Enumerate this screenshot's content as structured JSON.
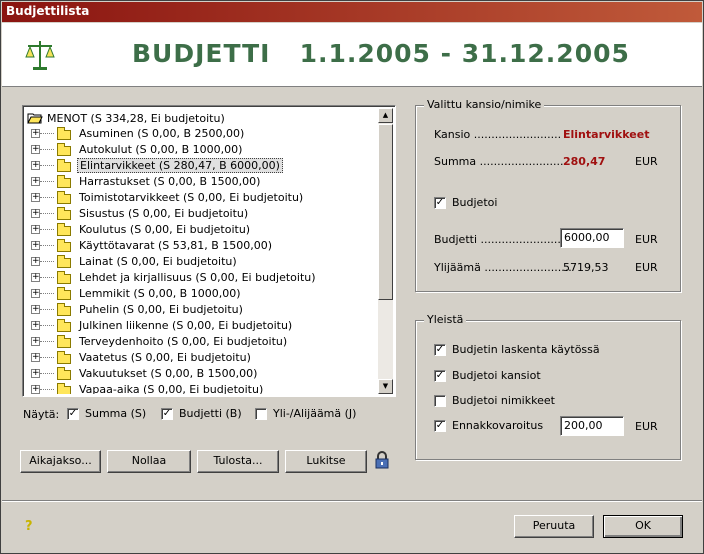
{
  "window": {
    "title": "Budjettilista"
  },
  "header": {
    "title": "BUDJETTI   1.1.2005 - 31.12.2005"
  },
  "tree": {
    "root": "MENOT  (S 334,28, Ei budjetoitu)",
    "items": [
      {
        "label": "Asuminen  (S 0,00, B 2500,00)"
      },
      {
        "label": "Autokulut  (S 0,00, B 1000,00)"
      },
      {
        "label": "Elintarvikkeet  (S 280,47, B 6000,00)",
        "selected": true
      },
      {
        "label": "Harrastukset  (S 0,00, B 1500,00)"
      },
      {
        "label": "Toimistotarvikkeet  (S 0,00, Ei budjetoitu)"
      },
      {
        "label": "Sisustus  (S 0,00, Ei budjetoitu)"
      },
      {
        "label": "Koulutus  (S 0,00, Ei budjetoitu)"
      },
      {
        "label": "Käyttötavarat  (S 53,81, B 1500,00)"
      },
      {
        "label": "Lainat  (S 0,00, Ei budjetoitu)"
      },
      {
        "label": "Lehdet ja kirjallisuus  (S 0,00, Ei budjetoitu)"
      },
      {
        "label": "Lemmikit  (S 0,00, B 1000,00)"
      },
      {
        "label": "Puhelin  (S 0,00, Ei budjetoitu)"
      },
      {
        "label": "Julkinen liikenne  (S 0,00, Ei budjetoitu)"
      },
      {
        "label": "Terveydenhoito  (S 0,00, Ei budjetoitu)"
      },
      {
        "label": "Vaatetus  (S 0,00, Ei budjetoitu)"
      },
      {
        "label": "Vakuutukset  (S 0,00, B 1500,00)"
      },
      {
        "label": "Vapaa-aika  (S 0,00, Ei budjetoitu)"
      }
    ]
  },
  "show": {
    "label": "Näytä:",
    "summa": {
      "label": "Summa (S)",
      "checked": true
    },
    "budjetti": {
      "label": "Budjetti (B)",
      "checked": true
    },
    "yli": {
      "label": "Yli-/Alijäämä (J)",
      "checked": false
    }
  },
  "buttons": {
    "aikajakso": "Aikajakso...",
    "nollaa": "Nollaa",
    "tulosta": "Tulosta...",
    "lukitse": "Lukitse",
    "peruuta": "Peruuta",
    "ok": "OK"
  },
  "selected_panel": {
    "title": "Valittu kansio/nimike",
    "kansio_label": "Kansio .........................",
    "kansio_value": "Elintarvikkeet",
    "summa_label": "Summa .........................",
    "summa_value": "280,47",
    "summa_unit": "EUR",
    "budjetoi_label": "Budjetoi",
    "budjetoi_checked": true,
    "budjetti_label": "Budjetti .........................",
    "budjetti_value": "6000,00",
    "budjetti_unit": "EUR",
    "ylijaama_label": "Ylijäämä .........................",
    "ylijaama_value": "5719,53",
    "ylijaama_unit": "EUR"
  },
  "general_panel": {
    "title": "Yleistä",
    "laskenta": {
      "label": "Budjetin laskenta käytössä",
      "checked": true
    },
    "kansiot": {
      "label": "Budjetoi kansiot",
      "checked": true
    },
    "nimikkeet": {
      "label": "Budjetoi nimikkeet",
      "checked": false
    },
    "ennakko": {
      "label": "Ennakkovaroitus",
      "checked": true,
      "value": "200,00",
      "unit": "EUR"
    }
  },
  "colors": {
    "title_bar": "#8a1410",
    "header_text": "#3d6e48",
    "value_red": "#a01010"
  },
  "icons": [
    "scale-icon",
    "folder-icon",
    "lock-icon",
    "help-icon"
  ]
}
